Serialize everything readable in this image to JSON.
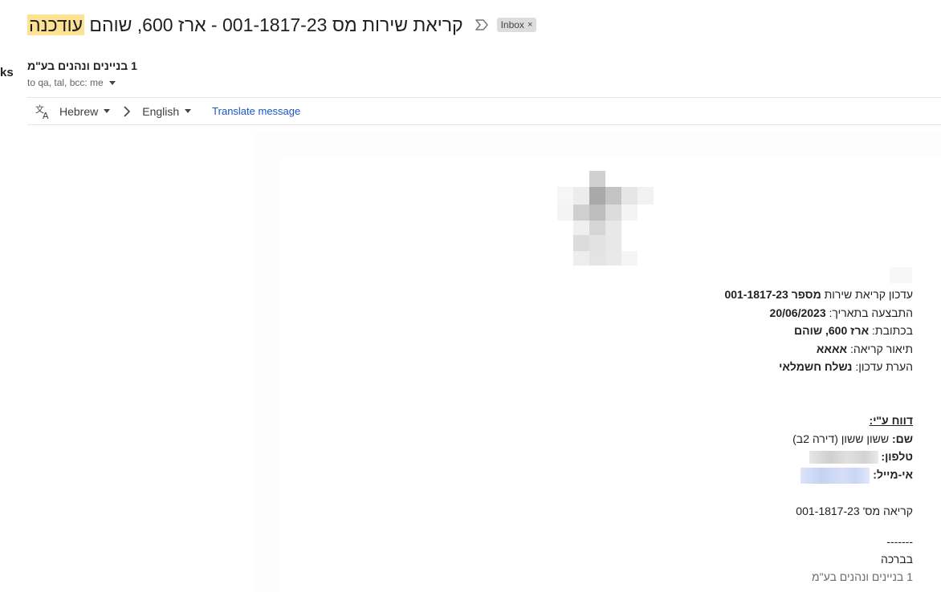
{
  "edge": {
    "char": "ks"
  },
  "subject": {
    "highlight": "עודכנה",
    "text_before": "קריאת שירות מס 001-1817-23 - ארז 600, שוהם",
    "label_chip": "Inbox",
    "label_chip_close": "×"
  },
  "sender": {
    "name": "1 בניינים ונהנים בע\"מ"
  },
  "recipients": {
    "text": "to qa, tal, bcc: me"
  },
  "translate": {
    "from_lang": "Hebrew",
    "to_lang": "English",
    "link": "Translate message"
  },
  "body": {
    "line1_prefix": "עדכון קריאת שירות ",
    "line1_bold": "מספר 001-1817-23",
    "line2_prefix": "התבצעה בתאריך: ",
    "line2_bold": "20/06/2023",
    "line3_prefix": "בכתובת: ",
    "line3_bold": "ארז 600, שוהם",
    "line4_prefix": "תיאור קריאה: ",
    "line4_bold": "אאאא",
    "line5_prefix": "הערת עדכון: ",
    "line5_bold": "נשלח חשמלאי",
    "report_heading": "דווח ע\"י:",
    "name_label": "שם:",
    "name_value": " ששון ששון (דירה 2ב)",
    "phone_label": "טלפון:",
    "email_label": "אי-מייל:",
    "call_no": "קריאה מס' 001-1817-23",
    "sep": "-------",
    "regards": "בברכה",
    "signature": "1 בניינים ונהנים בע\"מ"
  }
}
